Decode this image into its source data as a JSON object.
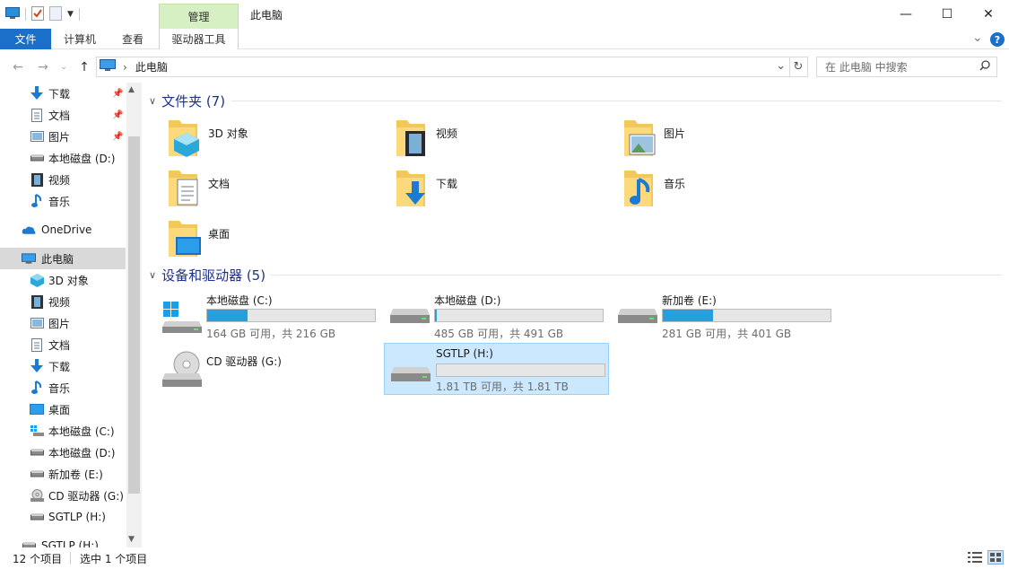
{
  "window": {
    "title": "此电脑",
    "context_tab": "管理",
    "controls": {
      "minimize": "—",
      "maximize": "☐",
      "close": "✕"
    }
  },
  "ribbon": {
    "tabs": [
      "文件",
      "计算机",
      "查看"
    ],
    "context_subtab": "驱动器工具",
    "collapse_glyph": "⌄",
    "help_glyph": "?"
  },
  "address": {
    "path": "此电脑",
    "separator": "›",
    "search_placeholder": "在 此电脑 中搜索",
    "dropdown_glyph": "⌄",
    "refresh_glyph": "↻"
  },
  "sidebar": {
    "quick": [
      {
        "label": "下载",
        "icon": "download-icon",
        "pinned": true
      },
      {
        "label": "文档",
        "icon": "document-icon",
        "pinned": true
      },
      {
        "label": "图片",
        "icon": "picture-icon",
        "pinned": true
      },
      {
        "label": "本地磁盘 (D:)",
        "icon": "drive-icon",
        "pinned": false
      },
      {
        "label": "视频",
        "icon": "video-icon",
        "pinned": false
      },
      {
        "label": "音乐",
        "icon": "music-icon",
        "pinned": false
      }
    ],
    "onedrive": "OneDrive",
    "thispc": "此电脑",
    "pc_items": [
      {
        "label": "3D 对象",
        "icon": "cube-icon"
      },
      {
        "label": "视频",
        "icon": "video-icon"
      },
      {
        "label": "图片",
        "icon": "picture-icon"
      },
      {
        "label": "文档",
        "icon": "document-icon"
      },
      {
        "label": "下载",
        "icon": "download-icon"
      },
      {
        "label": "音乐",
        "icon": "music-icon"
      },
      {
        "label": "桌面",
        "icon": "desktop-icon"
      },
      {
        "label": "本地磁盘 (C:)",
        "icon": "windows-drive-icon"
      },
      {
        "label": "本地磁盘 (D:)",
        "icon": "drive-icon"
      },
      {
        "label": "新加卷 (E:)",
        "icon": "drive-icon"
      },
      {
        "label": "CD 驱动器 (G:)",
        "icon": "cd-icon"
      },
      {
        "label": "SGTLP (H:)",
        "icon": "drive-icon"
      }
    ],
    "extra": "SGTLP (H:)"
  },
  "folders": {
    "header": "文件夹 (7)",
    "items": [
      {
        "label": "3D 对象",
        "icon": "cube-folder-icon"
      },
      {
        "label": "视频",
        "icon": "video-folder-icon"
      },
      {
        "label": "图片",
        "icon": "picture-folder-icon"
      },
      {
        "label": "文档",
        "icon": "document-folder-icon"
      },
      {
        "label": "下载",
        "icon": "download-folder-icon"
      },
      {
        "label": "音乐",
        "icon": "music-folder-icon"
      },
      {
        "label": "桌面",
        "icon": "desktop-folder-icon"
      }
    ]
  },
  "drives": {
    "header": "设备和驱动器 (5)",
    "items": [
      {
        "label": "本地磁盘 (C:)",
        "free": "164 GB 可用，共 216 GB",
        "used_fraction": 0.24,
        "icon": "windows-drive-icon"
      },
      {
        "label": "本地磁盘 (D:)",
        "free": "485 GB 可用，共 491 GB",
        "used_fraction": 0.012,
        "icon": "drive-icon"
      },
      {
        "label": "新加卷 (E:)",
        "free": "281 GB 可用，共 401 GB",
        "used_fraction": 0.3,
        "icon": "drive-icon"
      },
      {
        "label": "CD 驱动器 (G:)",
        "free": "",
        "used_fraction": null,
        "icon": "cd-drive-icon"
      },
      {
        "label": "SGTLP (H:)",
        "free": "1.81 TB 可用，共 1.81 TB",
        "used_fraction": 0.0,
        "icon": "drive-icon",
        "selected": true
      }
    ]
  },
  "status": {
    "count": "12 个项目",
    "selection": "选中 1 个项目"
  },
  "colors": {
    "accent": "#1a6fc8",
    "bar_fill": "#26a0da",
    "selected_bg": "#cce8ff",
    "header_text": "#1e3287"
  }
}
